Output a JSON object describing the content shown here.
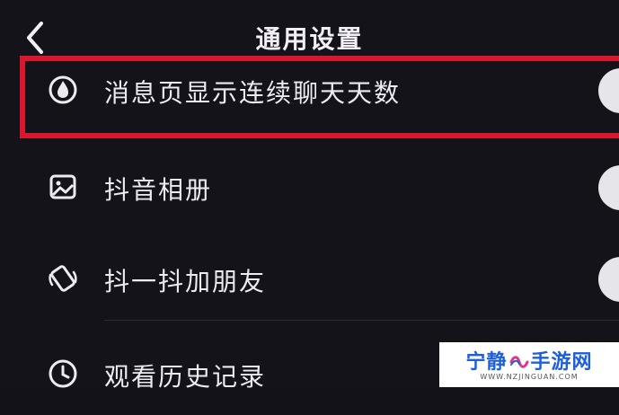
{
  "header": {
    "title": "通用设置"
  },
  "settings": [
    {
      "label": "消息页显示连续聊天天数",
      "icon": "flame-drop-icon"
    },
    {
      "label": "抖音相册",
      "icon": "photo-album-icon"
    },
    {
      "label": "抖一抖加朋友",
      "icon": "shake-phone-icon"
    },
    {
      "label": "观看历史记录",
      "icon": "clock-icon"
    }
  ],
  "watermark": {
    "name_left": "宁静",
    "name_right": "手游网",
    "url": "WWW.NZJINGUAN.COM"
  },
  "colors": {
    "background": "#15131a",
    "highlight": "#d8182e",
    "toggle_knob": "#e6e6ea",
    "watermark_text": "#1d5fd8"
  }
}
